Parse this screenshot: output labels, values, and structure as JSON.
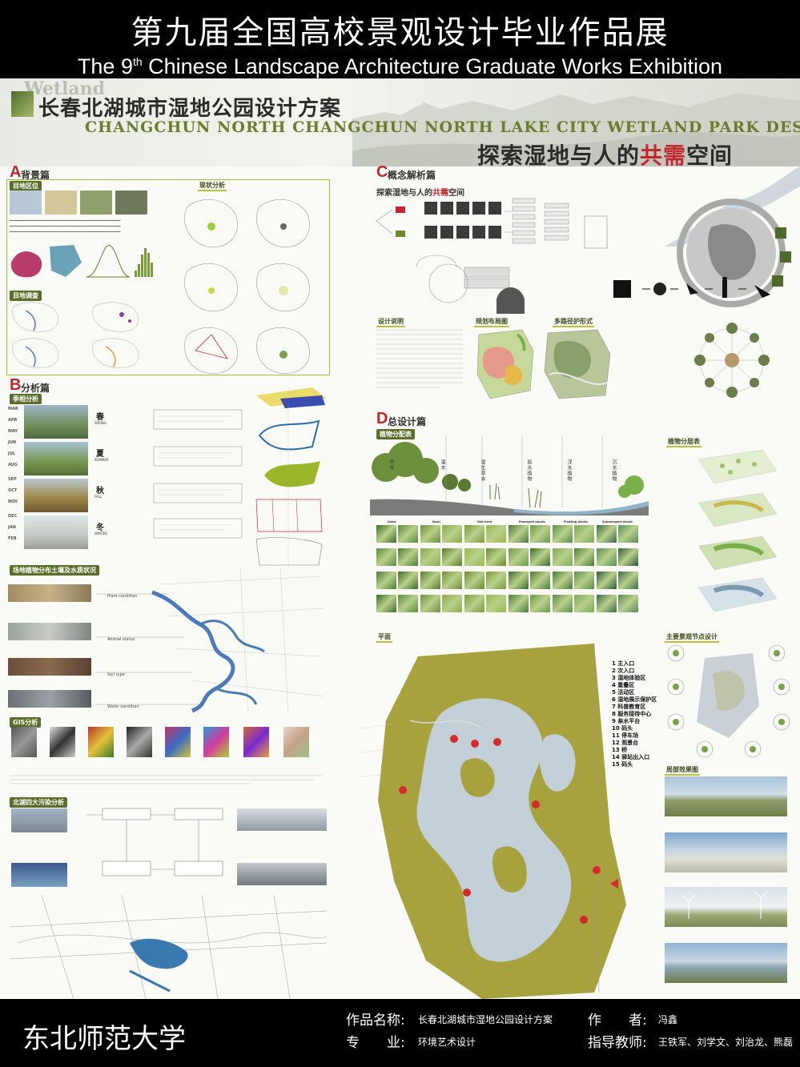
{
  "header": {
    "title_cn": "第九届全国高校景观设计毕业作品展",
    "title_en_pre": "The 9",
    "title_en_sup": "th",
    "title_en_post": " Chinese Landscape Architecture Graduate Works Exhibition"
  },
  "poster": {
    "wetland_tag": "Wetland",
    "title_cn": "长春北湖城市湿地公园设计方案",
    "title_en": "CHANGCHUN NORTH CHANGCHUN NORTH LAKE CITY WETLAND PARK DESIGN",
    "subtitle_pre": "探索湿地与人的",
    "subtitle_red": "共需",
    "subtitle_post": "空间",
    "sections": {
      "a": {
        "letter": "A",
        "title": "背景篇",
        "sub1": "目地区位",
        "sub2": "现状分析",
        "sub3": "目地调查"
      },
      "b": {
        "letter": "B",
        "title": "分析篇",
        "sub1": "季相分析",
        "sub2": "场地植物分布土壤及水质状况",
        "sub3": "GIS分析",
        "sub4": "北湖四大污染分析"
      },
      "c": {
        "letter": "C",
        "title": "概念解析篇",
        "concept_title_pre": "探索湿地与人的",
        "concept_title_red": "共需",
        "concept_title_post": "空间",
        "sub1": "设计说明",
        "sub2": "规划布局图",
        "sub3": "多路径护形式"
      },
      "d": {
        "letter": "D",
        "title": "总设计篇",
        "sub1": "植物分配表",
        "sub2": "植物分层表",
        "sub3": "平面",
        "sub4": "主要景观节点设计",
        "sub5": "局部效果图"
      }
    },
    "seasons": [
      {
        "cn": "春",
        "en": "SPRING",
        "months": [
          "MAR",
          "APR",
          "MAY"
        ]
      },
      {
        "cn": "夏",
        "en": "SUMMER",
        "months": [
          "JUN",
          "JUL",
          "AUG"
        ]
      },
      {
        "cn": "秋",
        "en": "FALL",
        "months": [
          "SEP",
          "OCT",
          "NOV"
        ]
      },
      {
        "cn": "冬",
        "en": "WINTER",
        "months": [
          "DEC",
          "JAN",
          "FEB"
        ]
      }
    ],
    "plant_categories": [
      "乔木",
      "灌木",
      "湿生草本",
      "挺水植物",
      "浮水植物",
      "沉水植物"
    ],
    "plant_categories_en": [
      "Arbor",
      "Bush",
      "Wet herb",
      "Emergent plants",
      "Floating plants",
      "Submergent plants"
    ],
    "soil_labels": [
      "Plant condition",
      "Animal status",
      "Soil type",
      "Water condition"
    ],
    "legend": [
      "1 主入口",
      "2 次入口",
      "3 湿地体验区",
      "4 重叠区",
      "5 活动区",
      "6 湿地展示保护区",
      "7 科普教育区",
      "8 服务接待中心",
      "9 亲水平台",
      "10 码头",
      "11 停车场",
      "12 观景台",
      "13 桥",
      "14 驿站出入口",
      "15 码头"
    ]
  },
  "footer": {
    "university": "东北师范大学",
    "work_label": "作品名称:",
    "work_value": "长春北湖城市湿地公园设计方案",
    "major_label": "专　　业:",
    "major_value": "环境艺术设计",
    "author_label": "作　　者:",
    "author_value": "冯鑫",
    "advisor_label": "指导教师:",
    "advisor_value": "王铁军、刘学文、刘治龙、熊磊"
  }
}
